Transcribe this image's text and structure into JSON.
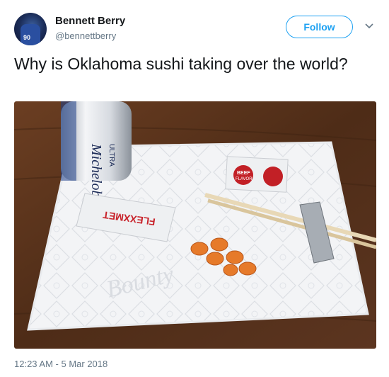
{
  "author": {
    "name": "Bennett Berry",
    "handle": "@bennettberry",
    "avatar_jersey_number": "90"
  },
  "follow_label": "Follow",
  "tweet": {
    "text": "Why is Oklahoma sushi taking over the world?"
  },
  "photo": {
    "can_text": "Michelob",
    "can_text_2": "ULTRA",
    "packet_left_text": "FLEXXMET",
    "packet_right_text_1": "BEEF",
    "packet_right_text_2": "FLAVOR",
    "towel_brand": "Bounty"
  },
  "timestamp": "12:23 AM - 5 Mar 2018",
  "colors": {
    "accent": "#1da1f2",
    "secondary_text": "#657786",
    "table_wood": "#5a3420"
  }
}
